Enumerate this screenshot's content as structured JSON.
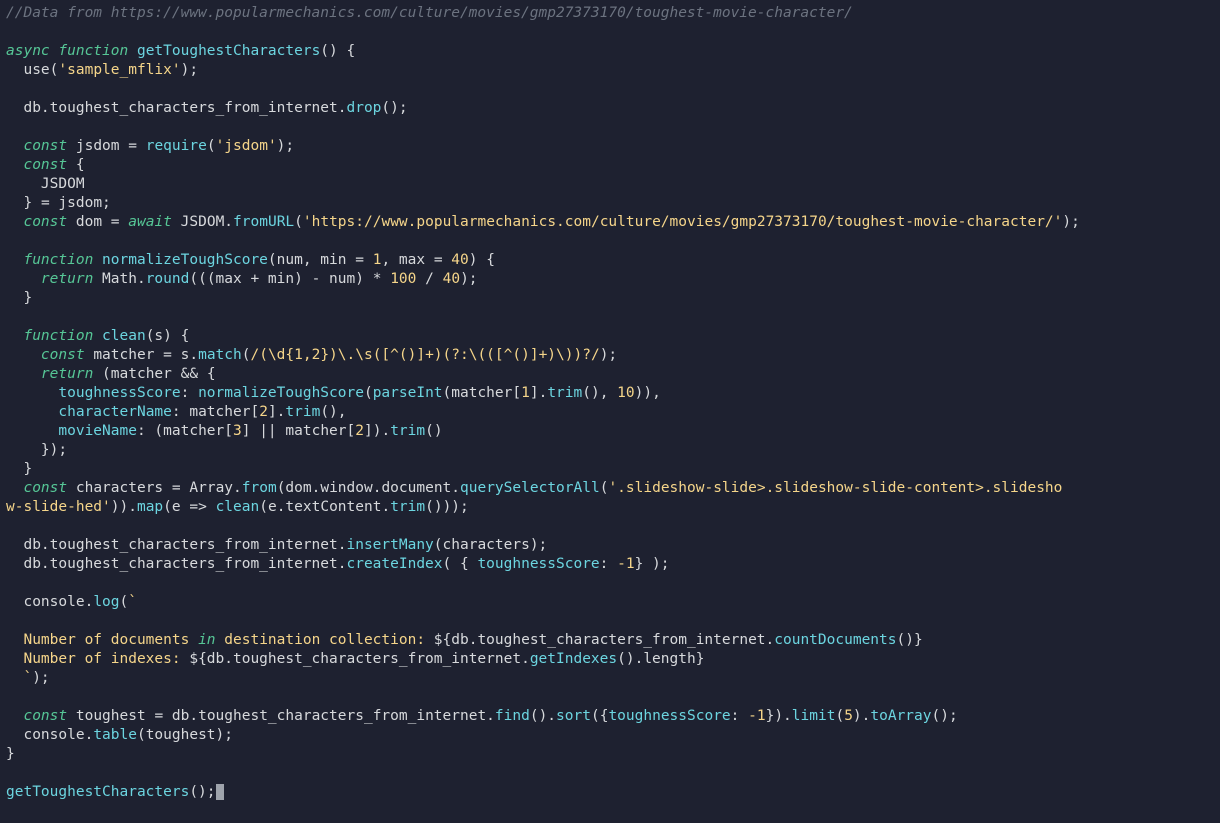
{
  "code": {
    "comment": "//Data from https://www.popularmechanics.com/culture/movies/gmp27373170/toughest-movie-character/",
    "fnName": "getToughestCharacters",
    "useArg": "'sample_mflix'",
    "coll": "toughest_characters_from_internet",
    "requireArg": "'jsdom'",
    "url": "'https://www.popularmechanics.com/culture/movies/gmp27373170/toughest-movie-character/'",
    "normArgs": "(num, min = 1, max = 40)",
    "normBody": "    return Math.round(((max + min) - num) * 100 / 40);",
    "regex": "/(\\d{1,2})\\.\\s([^()]+)(?:\\(([^()]+)\\))?/",
    "selector": "'.slideshow-slide>.slideshow-slide-content>.slidesho",
    "selectorWrap": "w-slide-hed'",
    "idxSpec": "{ toughnessScore: -1}",
    "logLine1": "  Number of documents in destination collection: ${db.toughest_characters_from_internet.countDocuments()}",
    "logLine2": "  Number of indexes: ${db.toughest_characters_from_internet.getIndexes().length}",
    "sortSpec": "{toughnessScore: -1}",
    "limit": "5",
    "callTail": "getToughestCharacters();"
  }
}
